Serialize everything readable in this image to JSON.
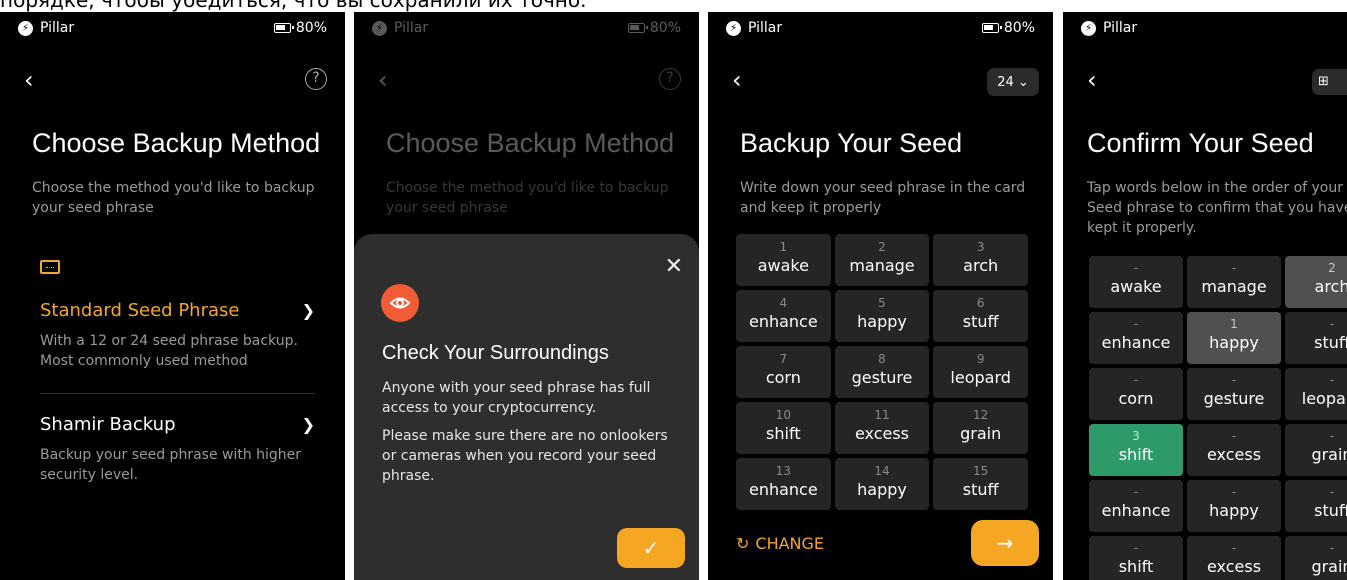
{
  "caption": "порядке, чтобы убедиться, что вы сохранили их точно.",
  "status": {
    "app": "Pillar",
    "battery": "80%"
  },
  "screen1": {
    "title": "Choose Backup Method",
    "subtitle": "Choose the method you'd like to backup your seed phrase",
    "options": [
      {
        "label": "Standard Seed Phrase",
        "desc": "With a 12 or 24 seed phrase backup. Most commonly used method"
      },
      {
        "label": "Shamir Backup",
        "desc": "Backup your seed phrase with higher security level."
      }
    ]
  },
  "screen2": {
    "title": "Choose Backup Method",
    "subtitle": "Choose the method you'd like to backup your seed phrase",
    "sheet": {
      "title": "Check Your Surroundings",
      "p1": "Anyone with your seed phrase has full access to your cryptocurrency.",
      "p2": "Please make sure there are no onlookers or cameras when you record your seed phrase."
    }
  },
  "screen3": {
    "title": "Backup Your Seed",
    "subtitle": "Write down your seed phrase in the card and keep it properly",
    "count": "24",
    "change_label": "CHANGE",
    "words": [
      {
        "n": "1",
        "w": "awake"
      },
      {
        "n": "2",
        "w": "manage"
      },
      {
        "n": "3",
        "w": "arch"
      },
      {
        "n": "4",
        "w": "enhance"
      },
      {
        "n": "5",
        "w": "happy"
      },
      {
        "n": "6",
        "w": "stuff"
      },
      {
        "n": "7",
        "w": "corn"
      },
      {
        "n": "8",
        "w": "gesture"
      },
      {
        "n": "9",
        "w": "leopard"
      },
      {
        "n": "10",
        "w": "shift"
      },
      {
        "n": "11",
        "w": "excess"
      },
      {
        "n": "12",
        "w": "grain"
      },
      {
        "n": "13",
        "w": "enhance"
      },
      {
        "n": "14",
        "w": "happy"
      },
      {
        "n": "15",
        "w": "stuff"
      }
    ]
  },
  "screen4": {
    "title": "Confirm Your Seed",
    "subtitle": "Tap words below in the order of your Seed phrase to confirm that you have kept it properly.",
    "words": [
      {
        "n": "-",
        "w": "awake",
        "state": ""
      },
      {
        "n": "-",
        "w": "manage",
        "state": ""
      },
      {
        "n": "2",
        "w": "arch",
        "state": "sel"
      },
      {
        "n": "-",
        "w": "enhance",
        "state": ""
      },
      {
        "n": "1",
        "w": "happy",
        "state": "sel"
      },
      {
        "n": "-",
        "w": "stuff",
        "state": ""
      },
      {
        "n": "-",
        "w": "corn",
        "state": ""
      },
      {
        "n": "-",
        "w": "gesture",
        "state": ""
      },
      {
        "n": "-",
        "w": "leopard",
        "state": ""
      },
      {
        "n": "3",
        "w": "shift",
        "state": "ok"
      },
      {
        "n": "-",
        "w": "excess",
        "state": ""
      },
      {
        "n": "-",
        "w": "grain",
        "state": ""
      },
      {
        "n": "-",
        "w": "enhance",
        "state": ""
      },
      {
        "n": "-",
        "w": "happy",
        "state": ""
      },
      {
        "n": "-",
        "w": "stuff",
        "state": ""
      },
      {
        "n": "-",
        "w": "shift",
        "state": ""
      },
      {
        "n": "-",
        "w": "excess",
        "state": ""
      },
      {
        "n": "-",
        "w": "grain",
        "state": ""
      }
    ]
  },
  "colors": {
    "accent": "#f5a623",
    "danger": "#f25c34",
    "success": "#2e9a6a"
  }
}
